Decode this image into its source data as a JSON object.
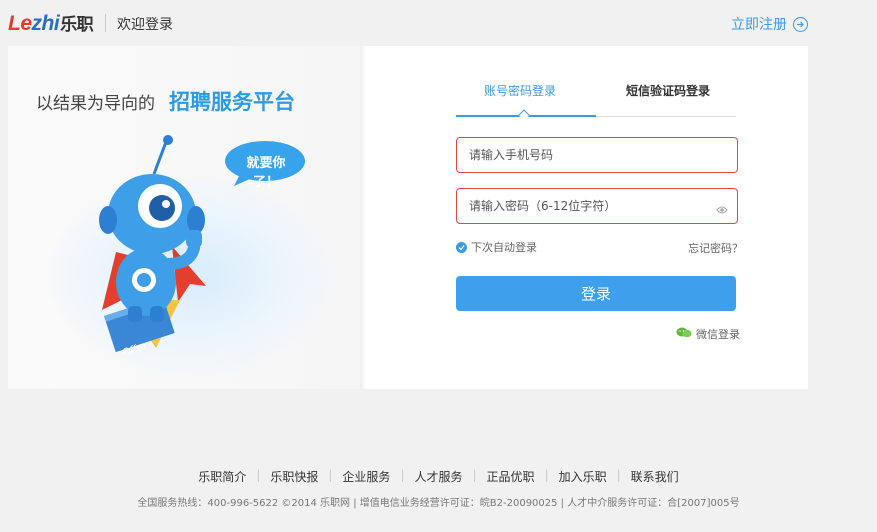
{
  "header": {
    "logo_part1": "Le",
    "logo_part2": "zhi",
    "logo_part3": "乐职",
    "welcome": "欢迎登录",
    "register_label": "立即注册"
  },
  "promo": {
    "slogan_prefix": "以结果为导向的",
    "slogan_highlight": "招聘服务平台",
    "bubble_text": "就要你了！",
    "offer_text": "Offer"
  },
  "login": {
    "tabs": [
      {
        "label": "账号密码登录",
        "active": true
      },
      {
        "label": "短信验证码登录",
        "active": false
      }
    ],
    "phone_placeholder": "请输入手机号码",
    "password_placeholder": "请输入密码（6-12位字符）",
    "remember_label": "下次自动登录",
    "remember_checked": true,
    "forgot_label": "忘记密码？",
    "submit_label": "登录",
    "wechat_label": "微信登录"
  },
  "footer": {
    "links": [
      "乐职简介",
      "乐职快报",
      "企业服务",
      "人才服务",
      "正品优职",
      "加入乐职",
      "联系我们"
    ],
    "legal": "全国服务热线：400-996-5622    ©2014 乐职网 | 增值电信业务经营许可证：皖B2-20090025 | 人才中介服务许可证：合[2007]005号"
  },
  "colors": {
    "accent": "#3b9be8",
    "error_border": "#e04848",
    "logo_red": "#e53a2c",
    "logo_blue": "#2a6fbf"
  }
}
